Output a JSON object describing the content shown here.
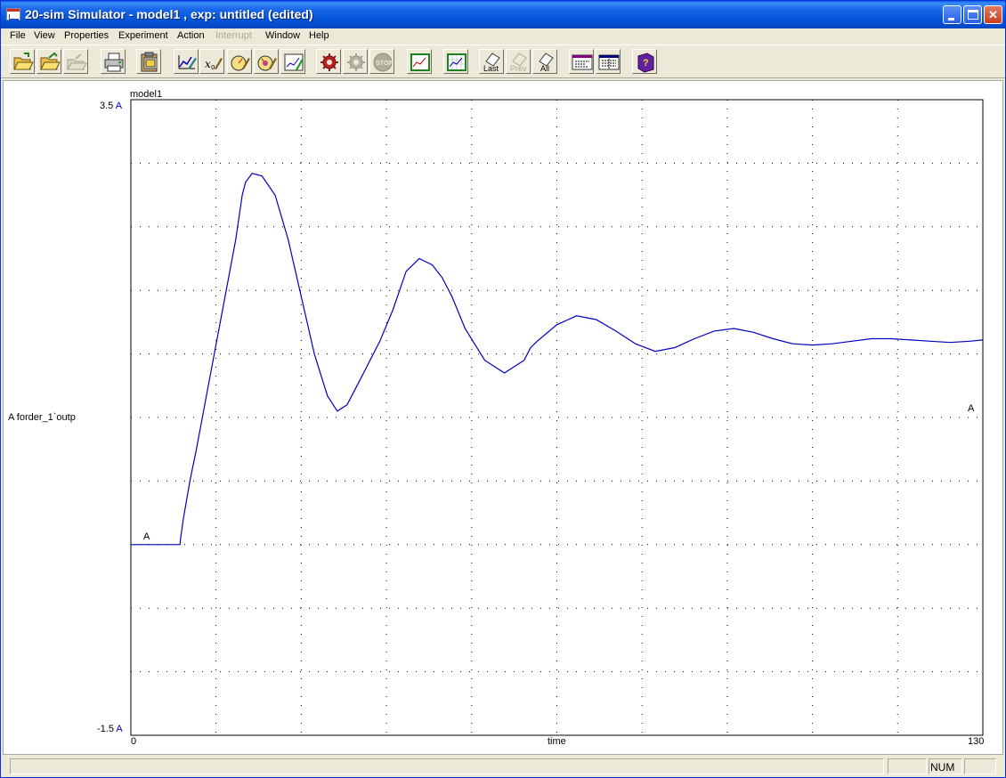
{
  "window": {
    "title": "20-sim  Simulator - model1 , exp: untitled (edited)"
  },
  "menu": {
    "items": [
      "File",
      "View",
      "Properties",
      "Experiment",
      "Action",
      "Interrupt",
      "Window",
      "Help"
    ],
    "disabled": [
      "Interrupt"
    ]
  },
  "toolbar": {
    "buttons": [
      {
        "name": "open-button",
        "icon": "open-folder-icon"
      },
      {
        "name": "open-experiment-button",
        "icon": "open-folder-arrow-icon"
      },
      {
        "name": "save-button",
        "icon": "save-folder-icon",
        "disabled": true
      },
      {
        "name": "print-button",
        "icon": "printer-icon"
      },
      {
        "name": "copy-plot-button",
        "icon": "clipboard-icon"
      },
      {
        "name": "plot-properties-button",
        "icon": "plot-pencil-icon"
      },
      {
        "name": "parameters-button",
        "icon": "x0-pencil-icon"
      },
      {
        "name": "run-properties-button",
        "icon": "gauge-pencil-icon"
      },
      {
        "name": "multiple-run-button",
        "icon": "gauge-pencil-color-icon"
      },
      {
        "name": "plot-window-button",
        "icon": "graph-pencil-icon"
      },
      {
        "name": "run-button",
        "icon": "gear-run-icon"
      },
      {
        "name": "continue-button",
        "icon": "gear-icon",
        "disabled": true
      },
      {
        "name": "stop-button",
        "icon": "stop-icon",
        "disabled": true
      },
      {
        "name": "fit-plot-button",
        "icon": "graph-icon"
      },
      {
        "name": "zoom-plot-button",
        "icon": "graph-grid-icon"
      },
      {
        "name": "erase-last-button",
        "icon": "eraser-icon",
        "label": "Last"
      },
      {
        "name": "erase-prev-button",
        "icon": "eraser-icon",
        "label": "Prev",
        "disabled": true
      },
      {
        "name": "erase-all-button",
        "icon": "eraser-icon",
        "label": "All"
      },
      {
        "name": "equations-button",
        "icon": "equation-icon"
      },
      {
        "name": "variables-button",
        "icon": "equation-grid-icon"
      },
      {
        "name": "help-button",
        "icon": "help-book-icon"
      }
    ]
  },
  "plot": {
    "model_label": "model1",
    "y_axis_label": "A forder_1`outp",
    "x_axis_label": "time",
    "y_max_label": "3.5",
    "y_min_label": "-1.5",
    "x_min_label": "0",
    "x_max_label": "130",
    "curve_label": "A",
    "line_color": "#0000C0"
  },
  "chart_data": {
    "type": "line",
    "xlabel": "time",
    "ylabel": "forder_1`outp",
    "xlim": [
      0,
      130
    ],
    "ylim": [
      -1.5,
      3.5
    ],
    "grid": true,
    "series": [
      {
        "name": "forder_1`outp",
        "x": [
          0,
          7.5,
          7.6,
          8,
          9,
          10,
          12,
          14,
          16,
          17,
          17.5,
          18.5,
          20,
          22,
          24,
          26,
          28,
          30,
          31.5,
          33,
          35,
          38,
          40,
          42,
          44,
          46,
          47.5,
          49,
          51,
          54,
          57,
          60,
          61,
          62,
          65,
          68,
          71,
          74,
          77,
          80,
          83,
          86,
          89,
          92,
          95,
          98,
          101,
          104,
          107,
          110,
          113,
          116,
          119,
          122,
          125,
          128,
          130
        ],
        "values": [
          0.0,
          0.0,
          0.05,
          0.2,
          0.5,
          0.75,
          1.3,
          1.85,
          2.4,
          2.75,
          2.85,
          2.92,
          2.9,
          2.75,
          2.4,
          1.95,
          1.5,
          1.17,
          1.05,
          1.1,
          1.3,
          1.6,
          1.85,
          2.15,
          2.25,
          2.2,
          2.1,
          1.95,
          1.7,
          1.45,
          1.35,
          1.45,
          1.55,
          1.6,
          1.73,
          1.8,
          1.77,
          1.68,
          1.58,
          1.52,
          1.55,
          1.62,
          1.68,
          1.7,
          1.67,
          1.62,
          1.58,
          1.57,
          1.58,
          1.6,
          1.62,
          1.62,
          1.61,
          1.6,
          1.59,
          1.6,
          1.61
        ]
      }
    ]
  },
  "status": {
    "num": "NUM"
  }
}
